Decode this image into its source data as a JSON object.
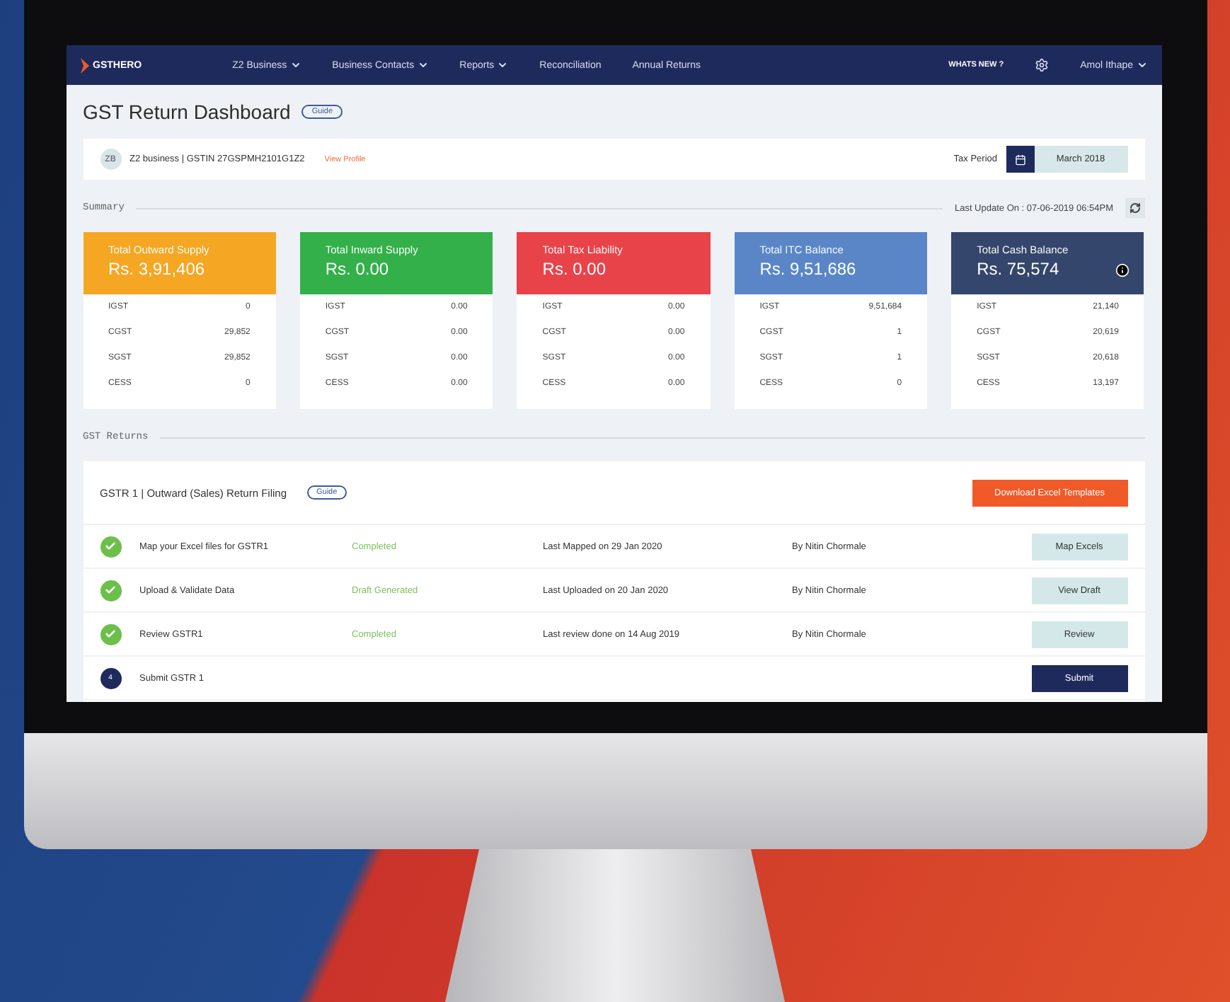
{
  "nav": {
    "logo": "GSTHERO",
    "items": [
      {
        "label": "Z2 Business",
        "dropdown": true
      },
      {
        "label": "Business Contacts",
        "dropdown": true
      },
      {
        "label": "Reports",
        "dropdown": true
      },
      {
        "label": "Reconciliation",
        "dropdown": false
      },
      {
        "label": "Annual Returns",
        "dropdown": false
      }
    ],
    "whats_new": "WHATS NEW ?",
    "user": "Amol Ithape"
  },
  "page_title": "GST Return Dashboard",
  "guide": "Guide",
  "business": {
    "initials": "ZB",
    "text": "Z2 business | GSTIN  27GSPMH2101G1Z2",
    "link": "View Profile",
    "period_label": "Tax Period",
    "period": "March 2018"
  },
  "summary": {
    "label": "Summary",
    "updated": "Last Update On : 07-06-2019 06:54PM"
  },
  "cards": [
    {
      "title": "Total Outward Supply",
      "amount": "Rs. 3,91,406",
      "color": "#f5a623",
      "info": false,
      "rows": [
        [
          "IGST",
          "0"
        ],
        [
          "CGST",
          "29,852"
        ],
        [
          "SGST",
          "29,852"
        ],
        [
          "CESS",
          "0"
        ]
      ]
    },
    {
      "title": "Total Inward Supply",
      "amount": "Rs. 0.00",
      "color": "#33b04a",
      "info": false,
      "rows": [
        [
          "IGST",
          "0.00"
        ],
        [
          "CGST",
          "0.00"
        ],
        [
          "SGST",
          "0.00"
        ],
        [
          "CESS",
          "0.00"
        ]
      ]
    },
    {
      "title": "Total Tax Liability",
      "amount": "Rs. 0.00",
      "color": "#e9434a",
      "info": false,
      "rows": [
        [
          "IGST",
          "0.00"
        ],
        [
          "CGST",
          "0.00"
        ],
        [
          "SGST",
          "0.00"
        ],
        [
          "CESS",
          "0.00"
        ]
      ]
    },
    {
      "title": "Total ITC Balance",
      "amount": "Rs. 9,51,686",
      "color": "#5a86c8",
      "info": false,
      "rows": [
        [
          "IGST",
          "9,51,684"
        ],
        [
          "CGST",
          "1"
        ],
        [
          "SGST",
          "1"
        ],
        [
          "CESS",
          "0"
        ]
      ]
    },
    {
      "title": "Total Cash Balance",
      "amount": "Rs. 75,574",
      "color": "#34466b",
      "info": true,
      "rows": [
        [
          "IGST",
          "21,140"
        ],
        [
          "CGST",
          "20,619"
        ],
        [
          "SGST",
          "20,618"
        ],
        [
          "CESS",
          "13,197"
        ]
      ]
    }
  ],
  "returns": {
    "label": "GST Returns",
    "title": "GSTR 1 | Outward (Sales) Return Filing",
    "guide": "Guide",
    "download": "Download Excel Templates",
    "steps": [
      {
        "done": true,
        "name": "Map your Excel files for GSTR1",
        "status": "Completed",
        "last": "Last Mapped on 29 Jan 2020",
        "by": "By Nitin Chormale",
        "button": "Map Excels",
        "kind": "secondary"
      },
      {
        "done": true,
        "name": "Upload & Validate Data",
        "status": "Draft Generated",
        "last": "Last Uploaded on 20 Jan 2020",
        "by": "By Nitin Chormale",
        "button": "View Draft",
        "kind": "secondary"
      },
      {
        "done": true,
        "name": "Review GSTR1",
        "status": "Completed",
        "last": "Last review done on 14 Aug 2019",
        "by": "By Nitin Chormale",
        "button": "Review",
        "kind": "secondary"
      },
      {
        "done": false,
        "number": "4",
        "name": "Submit GSTR 1",
        "button": "Submit",
        "kind": "primary"
      }
    ]
  }
}
